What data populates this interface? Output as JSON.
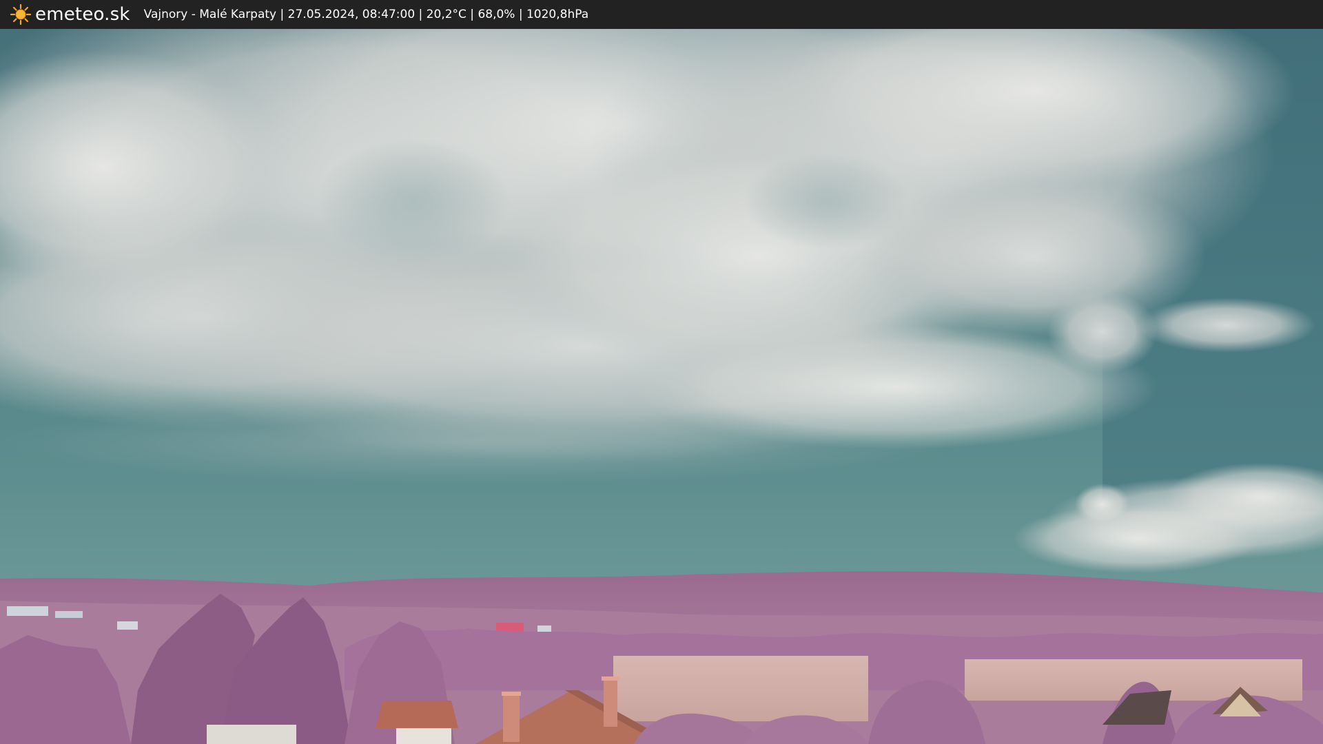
{
  "header": {
    "brand": "emeteo.sk",
    "logo_icon": "sun-icon",
    "caption": "Vajnory - Malé Karpaty | 27.05.2024, 08:47:00 | 20,2°C | 68,0% | 1020,8hPa"
  },
  "colors": {
    "header_bg": "#222222",
    "sun": "#f5a623",
    "sky_top": "#3c6e78",
    "sky_bottom": "#5d8d8e",
    "foliage": "#a9779d",
    "roof": "#b26a55"
  }
}
